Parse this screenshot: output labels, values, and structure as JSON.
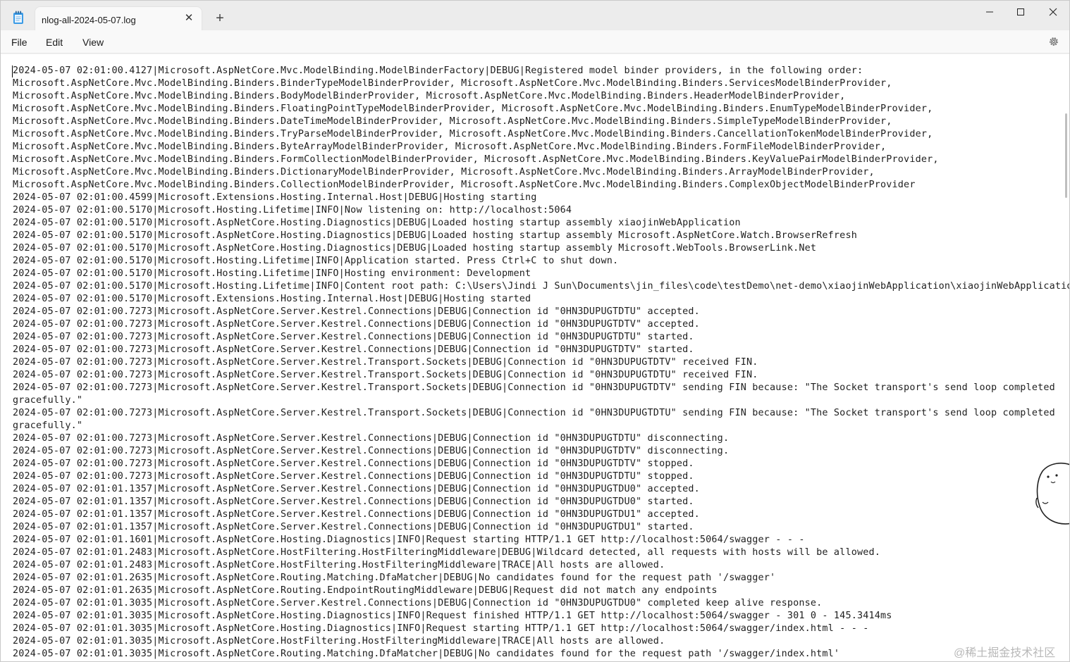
{
  "window": {
    "tab_title": "nlog-all-2024-05-07.log",
    "tab_close_glyph": "✕",
    "new_tab_glyph": "+",
    "minimize_glyph": "—",
    "maximize_glyph": "☐",
    "close_glyph": "✕"
  },
  "menu": {
    "file": "File",
    "edit": "Edit",
    "view": "View"
  },
  "icons": {
    "app": "notepad-icon",
    "settings": "gear-icon"
  },
  "editor": {
    "lines": [
      "2024-05-07 02:01:00.4127|Microsoft.AspNetCore.Mvc.ModelBinding.ModelBinderFactory|DEBUG|Registered model binder providers, in the following order:",
      "Microsoft.AspNetCore.Mvc.ModelBinding.Binders.BinderTypeModelBinderProvider, Microsoft.AspNetCore.Mvc.ModelBinding.Binders.ServicesModelBinderProvider,",
      "Microsoft.AspNetCore.Mvc.ModelBinding.Binders.BodyModelBinderProvider, Microsoft.AspNetCore.Mvc.ModelBinding.Binders.HeaderModelBinderProvider,",
      "Microsoft.AspNetCore.Mvc.ModelBinding.Binders.FloatingPointTypeModelBinderProvider, Microsoft.AspNetCore.Mvc.ModelBinding.Binders.EnumTypeModelBinderProvider,",
      "Microsoft.AspNetCore.Mvc.ModelBinding.Binders.DateTimeModelBinderProvider, Microsoft.AspNetCore.Mvc.ModelBinding.Binders.SimpleTypeModelBinderProvider,",
      "Microsoft.AspNetCore.Mvc.ModelBinding.Binders.TryParseModelBinderProvider, Microsoft.AspNetCore.Mvc.ModelBinding.Binders.CancellationTokenModelBinderProvider,",
      "Microsoft.AspNetCore.Mvc.ModelBinding.Binders.ByteArrayModelBinderProvider, Microsoft.AspNetCore.Mvc.ModelBinding.Binders.FormFileModelBinderProvider,",
      "Microsoft.AspNetCore.Mvc.ModelBinding.Binders.FormCollectionModelBinderProvider, Microsoft.AspNetCore.Mvc.ModelBinding.Binders.KeyValuePairModelBinderProvider,",
      "Microsoft.AspNetCore.Mvc.ModelBinding.Binders.DictionaryModelBinderProvider, Microsoft.AspNetCore.Mvc.ModelBinding.Binders.ArrayModelBinderProvider,",
      "Microsoft.AspNetCore.Mvc.ModelBinding.Binders.CollectionModelBinderProvider, Microsoft.AspNetCore.Mvc.ModelBinding.Binders.ComplexObjectModelBinderProvider",
      "2024-05-07 02:01:00.4599|Microsoft.Extensions.Hosting.Internal.Host|DEBUG|Hosting starting",
      "2024-05-07 02:01:00.5170|Microsoft.Hosting.Lifetime|INFO|Now listening on: http://localhost:5064",
      "2024-05-07 02:01:00.5170|Microsoft.AspNetCore.Hosting.Diagnostics|DEBUG|Loaded hosting startup assembly xiaojinWebApplication",
      "2024-05-07 02:01:00.5170|Microsoft.AspNetCore.Hosting.Diagnostics|DEBUG|Loaded hosting startup assembly Microsoft.AspNetCore.Watch.BrowserRefresh",
      "2024-05-07 02:01:00.5170|Microsoft.AspNetCore.Hosting.Diagnostics|DEBUG|Loaded hosting startup assembly Microsoft.WebTools.BrowserLink.Net",
      "2024-05-07 02:01:00.5170|Microsoft.Hosting.Lifetime|INFO|Application started. Press Ctrl+C to shut down.",
      "2024-05-07 02:01:00.5170|Microsoft.Hosting.Lifetime|INFO|Hosting environment: Development",
      "2024-05-07 02:01:00.5170|Microsoft.Hosting.Lifetime|INFO|Content root path: C:\\Users\\Jindi J Sun\\Documents\\jin_files\\code\\testDemo\\net-demo\\xiaojinWebApplication\\xiaojinWebApplication",
      "2024-05-07 02:01:00.5170|Microsoft.Extensions.Hosting.Internal.Host|DEBUG|Hosting started",
      "2024-05-07 02:01:00.7273|Microsoft.AspNetCore.Server.Kestrel.Connections|DEBUG|Connection id \"0HN3DUPUGTDTU\" accepted.",
      "2024-05-07 02:01:00.7273|Microsoft.AspNetCore.Server.Kestrel.Connections|DEBUG|Connection id \"0HN3DUPUGTDTV\" accepted.",
      "2024-05-07 02:01:00.7273|Microsoft.AspNetCore.Server.Kestrel.Connections|DEBUG|Connection id \"0HN3DUPUGTDTU\" started.",
      "2024-05-07 02:01:00.7273|Microsoft.AspNetCore.Server.Kestrel.Connections|DEBUG|Connection id \"0HN3DUPUGTDTV\" started.",
      "2024-05-07 02:01:00.7273|Microsoft.AspNetCore.Server.Kestrel.Transport.Sockets|DEBUG|Connection id \"0HN3DUPUGTDTV\" received FIN.",
      "2024-05-07 02:01:00.7273|Microsoft.AspNetCore.Server.Kestrel.Transport.Sockets|DEBUG|Connection id \"0HN3DUPUGTDTU\" received FIN.",
      "2024-05-07 02:01:00.7273|Microsoft.AspNetCore.Server.Kestrel.Transport.Sockets|DEBUG|Connection id \"0HN3DUPUGTDTV\" sending FIN because: \"The Socket transport's send loop completed",
      "gracefully.\"",
      "2024-05-07 02:01:00.7273|Microsoft.AspNetCore.Server.Kestrel.Transport.Sockets|DEBUG|Connection id \"0HN3DUPUGTDTU\" sending FIN because: \"The Socket transport's send loop completed",
      "gracefully.\"",
      "2024-05-07 02:01:00.7273|Microsoft.AspNetCore.Server.Kestrel.Connections|DEBUG|Connection id \"0HN3DUPUGTDTU\" disconnecting.",
      "2024-05-07 02:01:00.7273|Microsoft.AspNetCore.Server.Kestrel.Connections|DEBUG|Connection id \"0HN3DUPUGTDTV\" disconnecting.",
      "2024-05-07 02:01:00.7273|Microsoft.AspNetCore.Server.Kestrel.Connections|DEBUG|Connection id \"0HN3DUPUGTDTV\" stopped.",
      "2024-05-07 02:01:00.7273|Microsoft.AspNetCore.Server.Kestrel.Connections|DEBUG|Connection id \"0HN3DUPUGTDTU\" stopped.",
      "2024-05-07 02:01:01.1357|Microsoft.AspNetCore.Server.Kestrel.Connections|DEBUG|Connection id \"0HN3DUPUGTDU0\" accepted.",
      "2024-05-07 02:01:01.1357|Microsoft.AspNetCore.Server.Kestrel.Connections|DEBUG|Connection id \"0HN3DUPUGTDU0\" started.",
      "2024-05-07 02:01:01.1357|Microsoft.AspNetCore.Server.Kestrel.Connections|DEBUG|Connection id \"0HN3DUPUGTDU1\" accepted.",
      "2024-05-07 02:01:01.1357|Microsoft.AspNetCore.Server.Kestrel.Connections|DEBUG|Connection id \"0HN3DUPUGTDU1\" started.",
      "2024-05-07 02:01:01.1601|Microsoft.AspNetCore.Hosting.Diagnostics|INFO|Request starting HTTP/1.1 GET http://localhost:5064/swagger - - -",
      "2024-05-07 02:01:01.2483|Microsoft.AspNetCore.HostFiltering.HostFilteringMiddleware|DEBUG|Wildcard detected, all requests with hosts will be allowed.",
      "2024-05-07 02:01:01.2483|Microsoft.AspNetCore.HostFiltering.HostFilteringMiddleware|TRACE|All hosts are allowed.",
      "2024-05-07 02:01:01.2635|Microsoft.AspNetCore.Routing.Matching.DfaMatcher|DEBUG|No candidates found for the request path '/swagger'",
      "2024-05-07 02:01:01.2635|Microsoft.AspNetCore.Routing.EndpointRoutingMiddleware|DEBUG|Request did not match any endpoints",
      "2024-05-07 02:01:01.3035|Microsoft.AspNetCore.Server.Kestrel.Connections|DEBUG|Connection id \"0HN3DUPUGTDU0\" completed keep alive response.",
      "2024-05-07 02:01:01.3035|Microsoft.AspNetCore.Hosting.Diagnostics|INFO|Request finished HTTP/1.1 GET http://localhost:5064/swagger - 301 0 - 145.3414ms",
      "2024-05-07 02:01:01.3035|Microsoft.AspNetCore.Hosting.Diagnostics|INFO|Request starting HTTP/1.1 GET http://localhost:5064/swagger/index.html - - -",
      "2024-05-07 02:01:01.3035|Microsoft.AspNetCore.HostFiltering.HostFilteringMiddleware|TRACE|All hosts are allowed.",
      "2024-05-07 02:01:01.3035|Microsoft.AspNetCore.Routing.Matching.DfaMatcher|DEBUG|No candidates found for the request path '/swagger/index.html'"
    ]
  },
  "watermark": "@稀土掘金技术社区"
}
